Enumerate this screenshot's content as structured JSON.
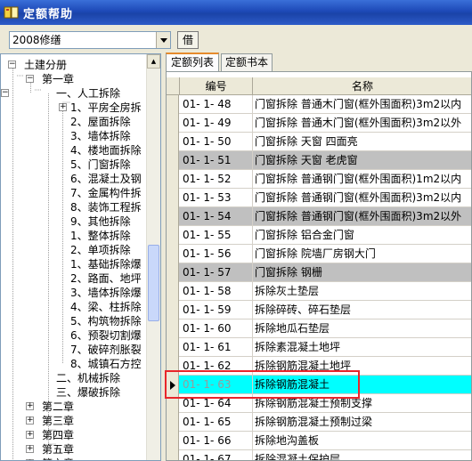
{
  "window": {
    "title": "定额帮助"
  },
  "toolbar": {
    "version_value": "2008修缮",
    "borrow_label": "借"
  },
  "tree": {
    "items": [
      {
        "label": "土建分册",
        "expander": "−"
      },
      {
        "label": "第一章",
        "expander": "−"
      },
      {
        "label": "一、人工拆除",
        "expander": "−"
      },
      {
        "label": "1、平房全房拆",
        "expander": "+"
      },
      {
        "label": "2、屋面拆除",
        "expander": ""
      },
      {
        "label": "3、墙体拆除",
        "expander": ""
      },
      {
        "label": "4、楼地面拆除",
        "expander": ""
      },
      {
        "label": "5、门窗拆除",
        "expander": ""
      },
      {
        "label": "6、混凝土及钢",
        "expander": ""
      },
      {
        "label": "7、金属构件拆",
        "expander": ""
      },
      {
        "label": "8、装饰工程拆",
        "expander": ""
      },
      {
        "label": "9、其他拆除",
        "expander": ""
      },
      {
        "label": "1、整体拆除",
        "expander": ""
      },
      {
        "label": "2、单项拆除",
        "expander": ""
      },
      {
        "label": "1、基础拆除爆",
        "expander": ""
      },
      {
        "label": "2、路面、地坪",
        "expander": ""
      },
      {
        "label": "3、墙体拆除爆",
        "expander": ""
      },
      {
        "label": "4、梁、柱拆除",
        "expander": ""
      },
      {
        "label": "5、构筑物拆除",
        "expander": ""
      },
      {
        "label": "6、预裂切割爆",
        "expander": ""
      },
      {
        "label": "7、破碎剂胀裂",
        "expander": ""
      },
      {
        "label": "8、城镇石方控",
        "expander": ""
      },
      {
        "label": "二、机械拆除",
        "expander": ""
      },
      {
        "label": "三、爆破拆除",
        "expander": ""
      },
      {
        "label": "第二章",
        "expander": "+"
      },
      {
        "label": "第三章",
        "expander": "+"
      },
      {
        "label": "第四章",
        "expander": "+"
      },
      {
        "label": "第五章",
        "expander": "+"
      },
      {
        "label": "第六章",
        "expander": "+"
      }
    ]
  },
  "tabs": [
    {
      "label": "定额列表"
    },
    {
      "label": "定额书本"
    }
  ],
  "grid": {
    "columns": [
      "编号",
      "名称"
    ],
    "rows": [
      {
        "code": "01- 1- 48",
        "name": "门窗拆除 普通木门窗(框外围面积)3m2以内",
        "style": "normal"
      },
      {
        "code": "01- 1- 49",
        "name": "门窗拆除 普通木门窗(框外围面积)3m2以外",
        "style": "normal"
      },
      {
        "code": "01- 1- 50",
        "name": "门窗拆除 天窗 四面亮",
        "style": "normal"
      },
      {
        "code": "01- 1- 51",
        "name": "门窗拆除 天窗 老虎窗",
        "style": "alt"
      },
      {
        "code": "01- 1- 52",
        "name": "门窗拆除 普通钢门窗(框外围面积)1m2以内",
        "style": "normal"
      },
      {
        "code": "01- 1- 53",
        "name": "门窗拆除 普通钢门窗(框外围面积)3m2以内",
        "style": "normal"
      },
      {
        "code": "01- 1- 54",
        "name": "门窗拆除 普通钢门窗(框外围面积)3m2以外",
        "style": "alt"
      },
      {
        "code": "01- 1- 55",
        "name": "门窗拆除 铝合金门窗",
        "style": "normal"
      },
      {
        "code": "01- 1- 56",
        "name": "门窗拆除 院墙厂房钢大门",
        "style": "normal"
      },
      {
        "code": "01- 1- 57",
        "name": "门窗拆除 钢栅",
        "style": "alt"
      },
      {
        "code": "01- 1- 58",
        "name": "拆除灰土垫层",
        "style": "normal"
      },
      {
        "code": "01- 1- 59",
        "name": "拆除碎砖、碎石垫层",
        "style": "normal"
      },
      {
        "code": "01- 1- 60",
        "name": "拆除地瓜石垫层",
        "style": "normal"
      },
      {
        "code": "01- 1- 61",
        "name": "拆除素混凝土地坪",
        "style": "normal"
      },
      {
        "code": "01- 1- 62",
        "name": "拆除钢筋混凝土地坪",
        "style": "normal"
      },
      {
        "code": "01- 1- 63",
        "name": "拆除钢筋混凝土",
        "style": "selected"
      },
      {
        "code": "01- 1- 64",
        "name": "拆除钢筋混凝土预制支撑",
        "style": "normal"
      },
      {
        "code": "01- 1- 65",
        "name": "拆除钢筋混凝土预制过梁",
        "style": "normal"
      },
      {
        "code": "01- 1- 66",
        "name": "拆除地沟盖板",
        "style": "normal"
      },
      {
        "code": "01- 1- 67",
        "name": "拆除混凝土保护层",
        "style": "normal"
      }
    ]
  },
  "colors": {
    "titlebar": "#1d49b7",
    "selected_row": "#00ffff",
    "alt_row": "#c0c0c0",
    "highlight_box": "#e8262b",
    "active_tab_accent": "#e68b2c"
  },
  "icons": {
    "window": "book-help-icon",
    "dropdown": "chevron-down-icon",
    "row_pointer": "triangle-right-icon"
  }
}
